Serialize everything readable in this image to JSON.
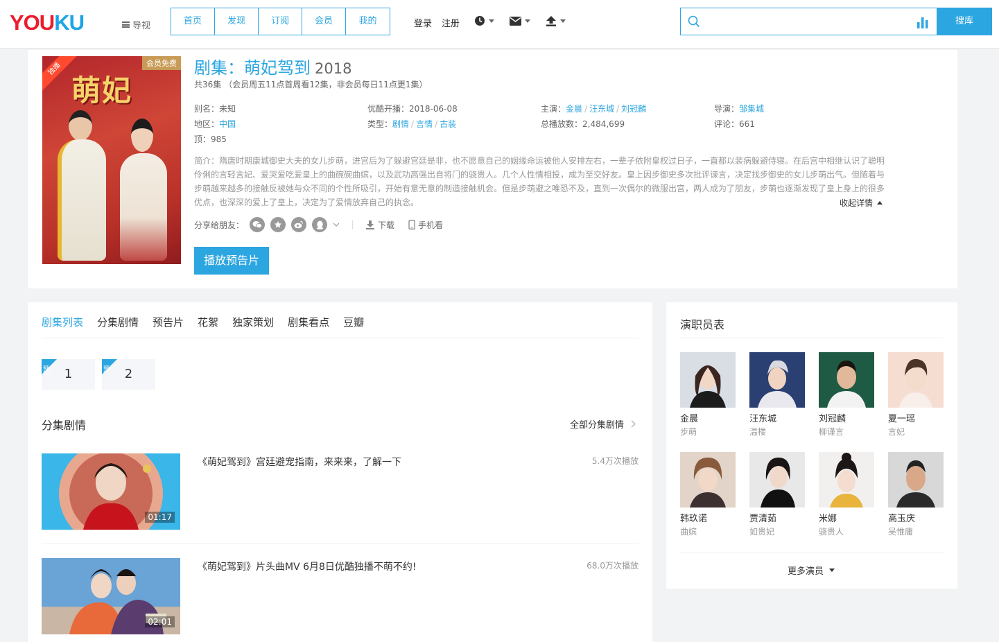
{
  "header": {
    "logo_you": "YOU",
    "logo_ku": "KU",
    "guide_label": "导视",
    "nav_tabs": [
      "首页",
      "发现",
      "订阅",
      "会员",
      "我的"
    ],
    "login": "登录",
    "register": "注册",
    "search_placeholder": "",
    "search_button": "搜库"
  },
  "show": {
    "poster_badge": "独播",
    "poster_vip": "会员免费",
    "poster_title": "萌妃",
    "title": "剧集：萌妃驾到",
    "year": "2018",
    "subtitle": "共36集 （会员周五11点首周看12集，非会员每日11点更1集）",
    "alias_label": "别名：",
    "alias": "未知",
    "premiere_label": "优酷开播：",
    "premiere": "2018-06-08",
    "starring_label": "主演：",
    "starring": [
      "金晨",
      "汪东城",
      "刘冠麟"
    ],
    "director_label": "导演：",
    "director": "邹集城",
    "region_label": "地区：",
    "region": "中国",
    "genre_label": "类型：",
    "genres": [
      "剧情",
      "言情",
      "古装"
    ],
    "plays_label": "总播放数：",
    "plays": "2,484,699",
    "comments_label": "评论：",
    "comments": "661",
    "likes_label": "顶：",
    "likes": "985",
    "description": "简介：隋唐时期康城御史大夫的女儿步萌，进宫后为了躲避宫廷是非，也不愿意自己的姻缘命运被他人安排左右，一辈子依附皇权过日子，一直都以装病躲避侍寝。在后宫中相继认识了聪明伶俐的言轻言妃、爱哭爱吃爱皇上的曲碗碗曲嫔，以及武功高强出自将门的骁贵人。几个人性情相投，成为至交好友。皇上因步御史多次批评谏言，决定找步御史的女儿步萌出气。但随着与步萌越来越多的接触反被她与众不同的个性所吸引，开始有意无意的制造接触机会。但是步萌避之唯恐不及，直到一次偶尔的微服出宫，两人成为了朋友，步萌也逐渐发现了皇上身上的很多优点，也深深的爱上了皇上，决定为了爱情放弃自己的执念。",
    "fold_label": "收起详情",
    "share_label": "分享给朋友：",
    "download_label": "下载",
    "mobile_label": "手机看",
    "trailer_button": "播放预告片"
  },
  "episodes": {
    "tabs": [
      "剧集列表",
      "分集剧情",
      "预告片",
      "花絮",
      "独家策划",
      "剧集看点",
      "豆瓣"
    ],
    "items": [
      {
        "tag": "预",
        "num": "1"
      },
      {
        "tag": "预",
        "num": "2"
      }
    ],
    "section_title": "分集剧情",
    "all_label": "全部分集剧情",
    "videos": [
      {
        "title": "《萌妃驾到》宫廷避宠指南，来来来，了解一下",
        "plays": "5.4万次播放",
        "duration": "01:17"
      },
      {
        "title": "《萌妃驾到》片头曲MV 6月8日优酷独播不萌不约!",
        "plays": "68.0万次播放",
        "duration": "02:01"
      }
    ]
  },
  "cast": {
    "title": "演职员表",
    "actors": [
      {
        "name": "金晨",
        "role": "步萌"
      },
      {
        "name": "汪东城",
        "role": "温楼"
      },
      {
        "name": "刘冠麟",
        "role": "柳谨言"
      },
      {
        "name": "夏一瑶",
        "role": "言妃"
      },
      {
        "name": "韩玖诺",
        "role": "曲嫔"
      },
      {
        "name": "贾清茹",
        "role": "如贵妃"
      },
      {
        "name": "米娜",
        "role": "骁贵人"
      },
      {
        "name": "高玉庆",
        "role": "吴惟庸"
      }
    ],
    "more_label": "更多演员"
  },
  "colors": {
    "accent": "#2ca6e0",
    "logo_red": "#ec1c2d",
    "logo_blue": "#1ca5e6"
  }
}
